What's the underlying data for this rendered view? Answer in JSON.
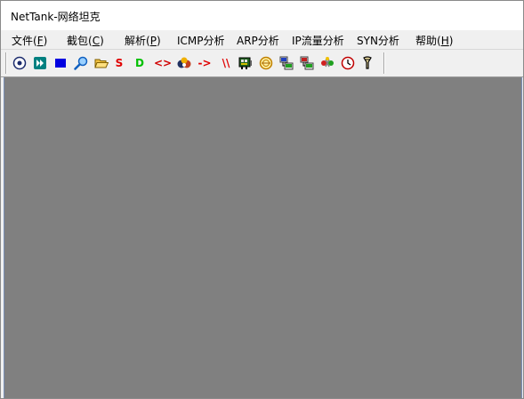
{
  "window": {
    "title": "NetTank-网络坦克"
  },
  "menu": {
    "items": [
      {
        "pre": "文件(",
        "acc": "F",
        "post": ")"
      },
      {
        "pre": "截包(",
        "acc": "C",
        "post": ")"
      },
      {
        "pre": "解析(",
        "acc": "P",
        "post": ")"
      },
      {
        "pre": "ICMP分析",
        "acc": "",
        "post": ""
      },
      {
        "pre": "ARP分析",
        "acc": "",
        "post": ""
      },
      {
        "pre": "IP流量分析",
        "acc": "",
        "post": ""
      },
      {
        "pre": "SYN分析",
        "acc": "",
        "post": ""
      },
      {
        "pre": "帮助(",
        "acc": "H",
        "post": ")"
      }
    ]
  },
  "toolbar": {
    "letter_s": "S",
    "letter_d": "D",
    "angle_brackets": "<>",
    "arrow": "->",
    "backslashes": "\\\\",
    "icons": [
      "adapter-select-icon",
      "start-capture-icon",
      "stop-capture-icon",
      "search-icon",
      "open-folder-icon",
      "source-filter-icon",
      "destination-filter-icon",
      "protocol-filter-icon",
      "packet-analysis-icon",
      "forward-icon",
      "split-icon",
      "network-card-icon",
      "globe-icon",
      "host-list-icon",
      "traffic-icon",
      "connection-icon",
      "timer-clock-icon",
      "filter-icon"
    ]
  },
  "colors": {
    "client_background": "#808080",
    "title_background": "#ffffff",
    "menu_background": "#f0f0f0",
    "letter_s": "#e00000",
    "letter_d": "#00c000",
    "stop_blue": "#0000e0",
    "teal": "#008080"
  }
}
